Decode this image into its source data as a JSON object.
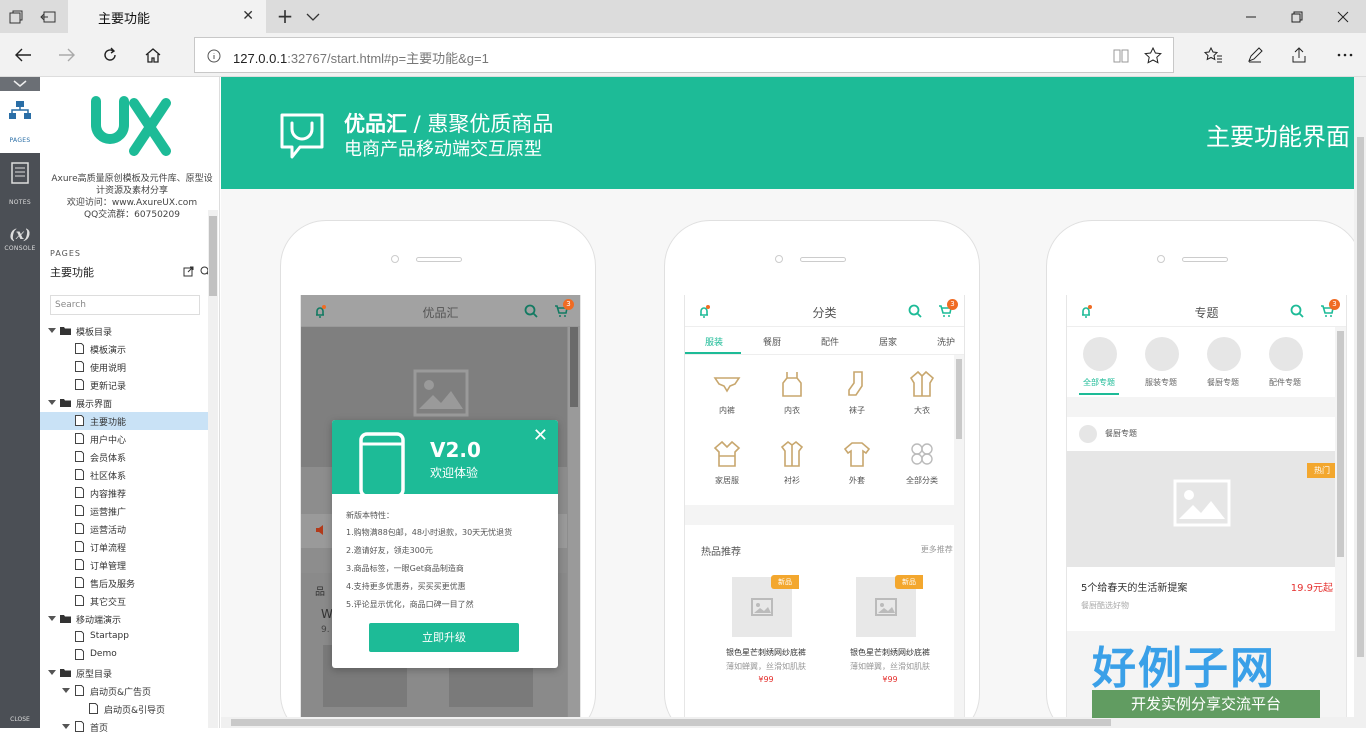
{
  "browser": {
    "tab_title": "主要功能",
    "url_host": "127.0.0.1",
    "url_rest": ":32767/start.html#p=主要功能&g=1"
  },
  "leftbar": {
    "pages_label": "PAGES",
    "notes_label": "NOTES",
    "console_label": "CONSOLE",
    "console_glyph": "(x)",
    "close_label": "CLOSE"
  },
  "panel": {
    "logo_text": "Axure高质量原创模板及元件库、原型设计资源及素材分享",
    "logo_visit": "欢迎访问：www.AxureUX.com",
    "logo_qq": "QQ交流群：60750209",
    "pages_header": "PAGES",
    "current_page": "主要功能",
    "search_placeholder": "Search"
  },
  "tree": [
    {
      "label": "模板目录",
      "level": 0,
      "type": "folder",
      "open": true
    },
    {
      "label": "模板演示",
      "level": 1,
      "type": "page"
    },
    {
      "label": "使用说明",
      "level": 1,
      "type": "page"
    },
    {
      "label": "更新记录",
      "level": 1,
      "type": "page"
    },
    {
      "label": "展示界面",
      "level": 0,
      "type": "folder",
      "open": true
    },
    {
      "label": "主要功能",
      "level": 1,
      "type": "page",
      "selected": true
    },
    {
      "label": "用户中心",
      "level": 1,
      "type": "page"
    },
    {
      "label": "会员体系",
      "level": 1,
      "type": "page"
    },
    {
      "label": "社区体系",
      "level": 1,
      "type": "page"
    },
    {
      "label": "内容推荐",
      "level": 1,
      "type": "page"
    },
    {
      "label": "运营推广",
      "level": 1,
      "type": "page"
    },
    {
      "label": "运营活动",
      "level": 1,
      "type": "page"
    },
    {
      "label": "订单流程",
      "level": 1,
      "type": "page"
    },
    {
      "label": "订单管理",
      "level": 1,
      "type": "page"
    },
    {
      "label": "售后及服务",
      "level": 1,
      "type": "page"
    },
    {
      "label": "其它交互",
      "level": 1,
      "type": "page"
    },
    {
      "label": "移动端演示",
      "level": 0,
      "type": "folder",
      "open": true
    },
    {
      "label": "Startapp",
      "level": 1,
      "type": "page"
    },
    {
      "label": "Demo",
      "level": 1,
      "type": "page"
    },
    {
      "label": "原型目录",
      "level": 0,
      "type": "folder",
      "open": true
    },
    {
      "label": "启动页&广告页",
      "level": 1,
      "type": "page",
      "open": true
    },
    {
      "label": "启动页&引导页",
      "level": 2,
      "type": "page"
    },
    {
      "label": "首页",
      "level": 1,
      "type": "page",
      "open": true
    }
  ],
  "banner": {
    "brand": "优品汇",
    "slogan": " / 惠聚优质商品",
    "subtitle": "电商产品移动端交互原型",
    "right_title": "主要功能界面"
  },
  "phone1": {
    "title": "优品汇",
    "cart_count": "3",
    "section_title": "品",
    "item_word": "W",
    "item_num": "9."
  },
  "popup": {
    "version": "V2.0",
    "welcome": "欢迎体验",
    "features_title": "新版本特性：",
    "features": [
      "1.购物满88包邮，48小时退款，30天无忧退货",
      "2.邀请好友，领走300元",
      "3.商品标签，一眼Get商品制造商",
      "4.支持更多优惠券，买买买更优惠",
      "5.评论显示优化，商品口碑一目了然"
    ],
    "button": "立即升级",
    "close": "✕"
  },
  "phone2": {
    "title": "分类",
    "cart_count": "3",
    "tabs": [
      "服装",
      "餐厨",
      "配件",
      "居家",
      "洗护"
    ],
    "categories": [
      "内裤",
      "内衣",
      "袜子",
      "大衣",
      "家居服",
      "衬衫",
      "外套",
      "全部分类"
    ],
    "hot_title": "热品推荐",
    "hot_more": "更多推荐",
    "products": [
      {
        "badge": "新品",
        "name": "银色星芒刺绣网纱底裤",
        "desc": "薄如蝉翼，丝滑如肌肤",
        "price": "¥99"
      },
      {
        "badge": "新品",
        "name": "银色星芒刺绣网纱底裤",
        "desc": "薄如蝉翼，丝滑如肌肤",
        "price": "¥99"
      }
    ]
  },
  "phone3": {
    "title": "专题",
    "cart_count": "3",
    "topics": [
      "全部专题",
      "服装专题",
      "餐厨专题",
      "配件专题"
    ],
    "section": "餐厨专题",
    "hot_tag": "热门",
    "item_title": "5个给春天的生活新提案",
    "item_price": "19.9元起",
    "item_sub": "餐厨酷选好物"
  },
  "watermark": {
    "line1": "好例子网",
    "line2": "开发实例分享交流平台"
  },
  "colors": {
    "brand": "#1dbb97",
    "accent": "#f3a72e",
    "price": "#e5312f",
    "selected_row": "#c9e2f6"
  }
}
